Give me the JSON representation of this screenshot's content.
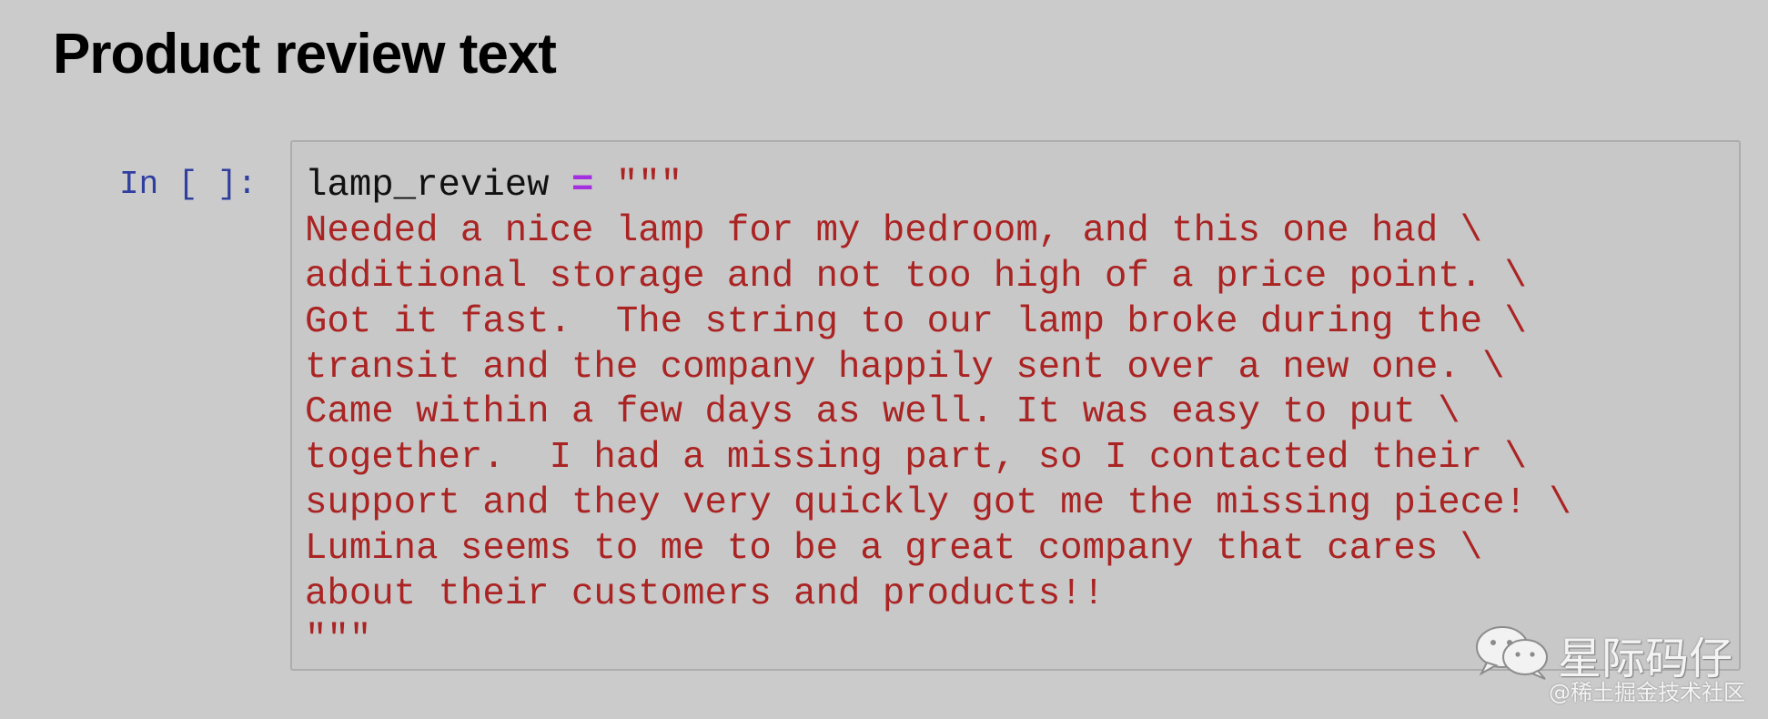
{
  "notebook": {
    "heading": "Product review text",
    "cell": {
      "prompt": "In [ ]:",
      "variable": "lamp_review",
      "operator": " = ",
      "string_lines": [
        "\"\"\"",
        "Needed a nice lamp for my bedroom, and this one had \\",
        "additional storage and not too high of a price point. \\",
        "Got it fast.  The string to our lamp broke during the \\",
        "transit and the company happily sent over a new one. \\",
        "Came within a few days as well. It was easy to put \\",
        "together.  I had a missing part, so I contacted their \\",
        "support and they very quickly got me the missing piece! \\",
        "Lumina seems to me to be a great company that cares \\",
        "about their customers and products!!",
        "\"\"\""
      ]
    }
  },
  "watermark": {
    "title": "星际码仔",
    "subtitle": "@稀土掘金技术社区",
    "icon": "wechat-icon"
  },
  "colors": {
    "background": "#cbcbcb",
    "prompt": "#303f9f",
    "string": "#ab2424",
    "operator": "#a22fe0"
  }
}
